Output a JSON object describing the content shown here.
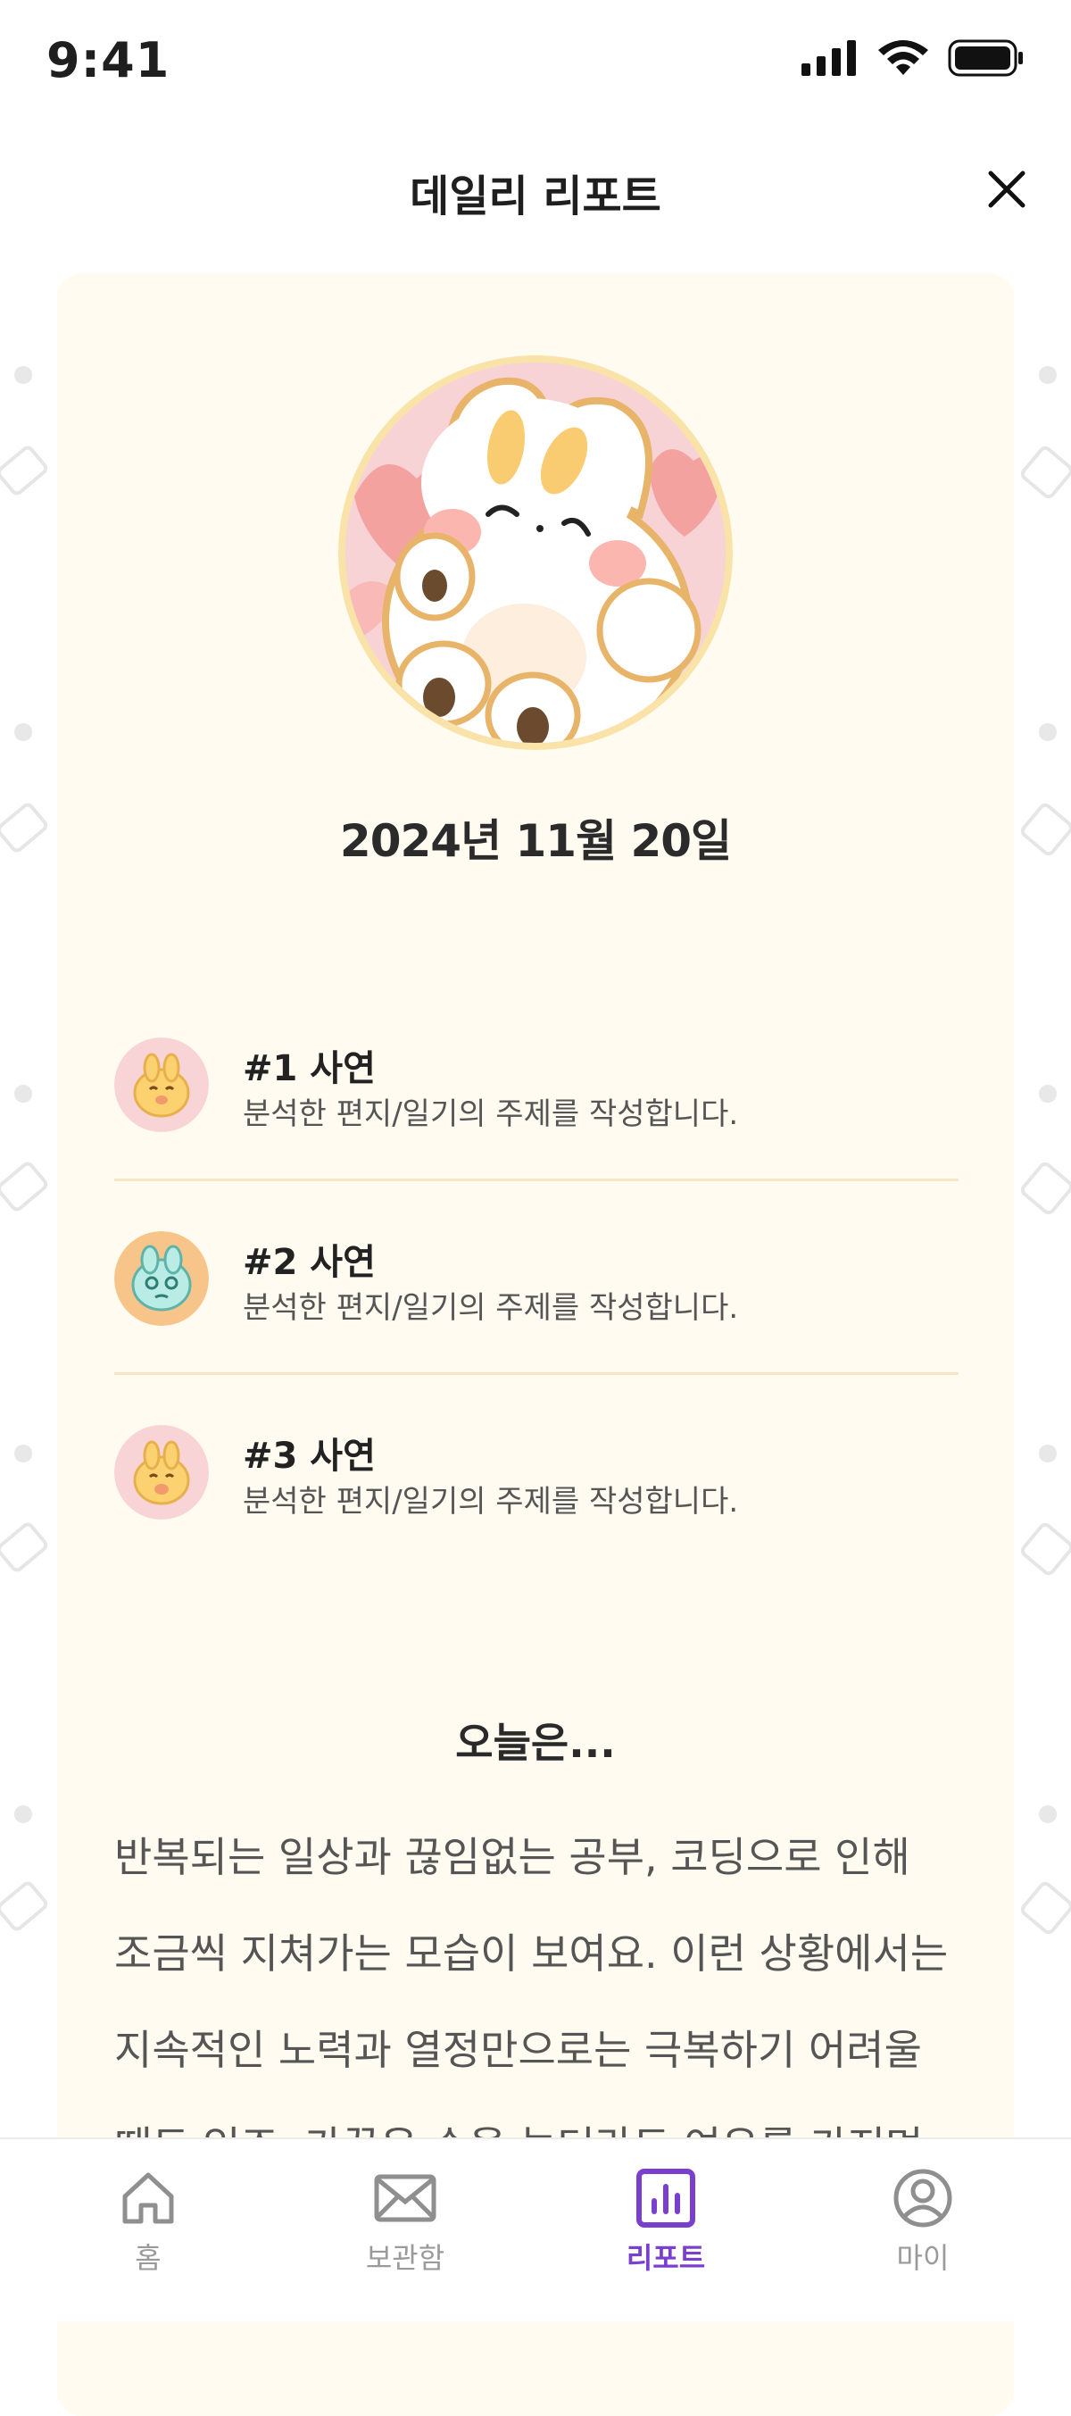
{
  "status_bar": {
    "time": "9:41"
  },
  "header": {
    "title": "데일리 리포트"
  },
  "report": {
    "date": "2024년 11월 20일",
    "topics": [
      {
        "title": "#1 사연",
        "description": "분석한 편지/일기의 주제를 작성합니다."
      },
      {
        "title": "#2 사연",
        "description": "분석한 편지/일기의 주제를 작성합니다."
      },
      {
        "title": "#3 사연",
        "description": "분석한 편지/일기의 주제를 작성합니다."
      }
    ],
    "today_title": "오늘은...",
    "today_body": "반복되는 일상과 끊임없는 공부, 코딩으로 인해 조금씩 지쳐가는 모습이 보여요. 이런 상황에서는 지속적인 노력과 열정만으로는 극복하기 어려울 때도 있죠. 가끔은 손을 놓더라도 여유를 가지며 마음을 편안하게"
  },
  "tab_bar": {
    "tabs": [
      {
        "label": "홈",
        "icon": "home-icon",
        "active": false
      },
      {
        "label": "보관함",
        "icon": "mail-icon",
        "active": false
      },
      {
        "label": "리포트",
        "icon": "report-chart-icon",
        "active": true
      },
      {
        "label": "마이",
        "icon": "profile-icon",
        "active": false
      }
    ]
  },
  "colors": {
    "accent": "#7b3fd0",
    "card_background": "#fffbf0",
    "divider": "#f6e6c4",
    "inactive_tab": "#9a9a9a"
  }
}
